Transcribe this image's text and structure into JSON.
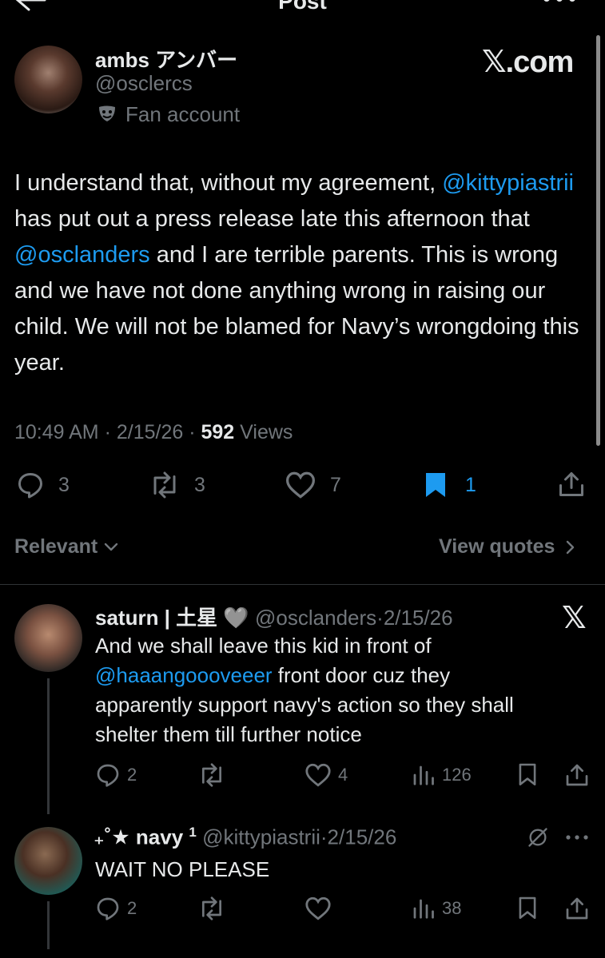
{
  "header": {
    "title": "Post"
  },
  "tweet": {
    "display_name": "ambs アンバー",
    "handle": "@osclercs",
    "badge": "Fan account",
    "source_logo": "𝕏.com",
    "body": {
      "p1": "I understand that, without my agreement, ",
      "m1": "@kittypiastrii",
      "p2": " has put out a press release late this afternoon that ",
      "m2": "@osclanders",
      "p3": " and I are terrible parents. This is wrong and we have not done anything wrong in raising our child. We will not be blamed for Navy’s wrongdoing this year."
    },
    "time": "10:49 AM",
    "date": "2/15/26",
    "views_count": "592",
    "views_label": "Views",
    "replies": "3",
    "reposts": "3",
    "likes": "7",
    "bookmarks": "1"
  },
  "sort": {
    "label": "Relevant",
    "view_quotes": "View quotes"
  },
  "replies": [
    {
      "display_name": "saturn | 土星 🩶",
      "handle": "@osclanders",
      "sep": "·",
      "date": "2/15/26",
      "text_a": "And we shall leave this kid in front of",
      "mention": "@haaangoooveeer",
      "text_b": " front door cuz they",
      "text_c": "apparently support navy's action so they shall",
      "text_d": "shelter them till further notice",
      "replies": "2",
      "likes": "4",
      "views": "126"
    },
    {
      "display_name": "₊˚★ navy",
      "superscript": "1",
      "handle": "@kittypiastrii",
      "sep": "·",
      "date": "2/15/26",
      "text": "WAIT NO PLEASE",
      "replies": "2",
      "views": "38"
    }
  ],
  "icons": {
    "back": "back-arrow-icon",
    "more": "more-icon",
    "reply": "reply-icon",
    "repost": "repost-icon",
    "like": "heart-icon",
    "bookmark": "bookmark-icon",
    "share": "share-icon",
    "views": "views-icon"
  },
  "colors": {
    "accent": "#1d9bf0",
    "muted": "#71767b",
    "background": "#000000"
  }
}
